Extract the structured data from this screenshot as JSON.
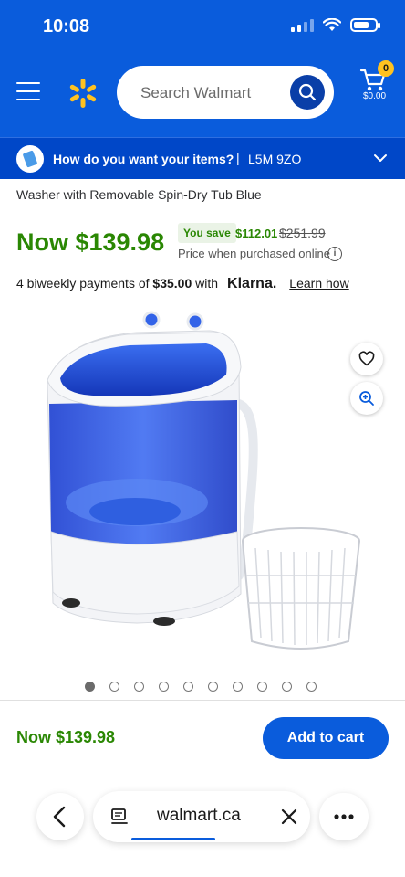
{
  "status_bar": {
    "time": "10:08"
  },
  "header": {
    "search_placeholder": "Search Walmart",
    "cart_count": "0",
    "cart_total": "$0.00"
  },
  "delivery": {
    "question": "How do you want your items?",
    "separator": "|",
    "postal_code": "L5M 9ZO"
  },
  "product": {
    "title": "Washer with Removable Spin-Dry Tub Blue",
    "price_now": "Now $139.98",
    "you_save_label": "You save",
    "save_amount": "$112.01",
    "was_price": "$251.99",
    "price_note": "Price when purchased online",
    "klarna": {
      "prefix": "4 biweekly payments of",
      "amount": "$35.00",
      "with": "with",
      "logo": "Klarna.",
      "link": "Learn how"
    },
    "image_count": 10,
    "active_image": 0
  },
  "buy_bar": {
    "price": "Now $139.98",
    "add_to_cart": "Add to cart"
  },
  "browser": {
    "url": "walmart.ca"
  },
  "colors": {
    "brand_blue": "#0a5cdc",
    "delivery_blue": "#0047c8",
    "spark_yellow": "#ffc220",
    "price_green": "#2a8703"
  },
  "icons": [
    "menu-icon",
    "walmart-spark-icon",
    "search-icon",
    "cart-icon",
    "delivery-icon",
    "chevron-down-icon",
    "info-icon",
    "heart-icon",
    "zoom-in-icon",
    "back-icon",
    "reader-icon",
    "close-icon",
    "more-icon"
  ]
}
